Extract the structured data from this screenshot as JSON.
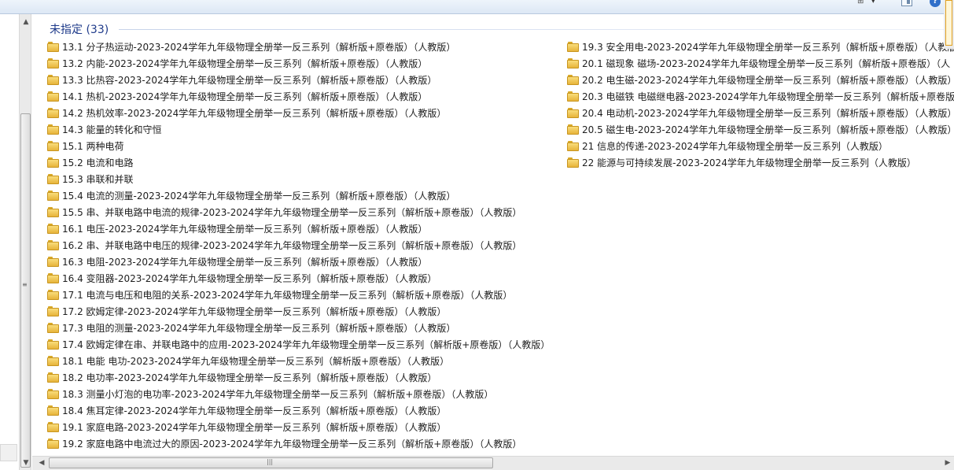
{
  "toolbar": {
    "views_icon": "views-icon",
    "views_glyph": "⊞",
    "views_chevron": "▾",
    "pane_icon": "preview-pane-icon",
    "help_icon": "help-icon",
    "help_glyph": "?"
  },
  "scroll": {
    "up_glyph": "▲",
    "down_glyph": "▼",
    "left_glyph": "◀",
    "right_glyph": "▶",
    "vgrip": "≡",
    "hgrip": "|||"
  },
  "group": {
    "title": "未指定 (33)"
  },
  "items": [
    {
      "name": "13.1  分子热运动-2023-2024学年九年级物理全册举一反三系列（解析版+原卷版）（人教版）"
    },
    {
      "name": "13.2  内能-2023-2024学年九年级物理全册举一反三系列（解析版+原卷版）（人教版）"
    },
    {
      "name": "13.3  比热容-2023-2024学年九年级物理全册举一反三系列（解析版+原卷版）（人教版）"
    },
    {
      "name": "14.1  热机-2023-2024学年九年级物理全册举一反三系列（解析版+原卷版）（人教版）"
    },
    {
      "name": "14.2  热机效率-2023-2024学年九年级物理全册举一反三系列（解析版+原卷版）（人教版）"
    },
    {
      "name": "14.3  能量的转化和守恒"
    },
    {
      "name": "15.1  两种电荷"
    },
    {
      "name": "15.2  电流和电路"
    },
    {
      "name": "15.3  串联和并联"
    },
    {
      "name": "15.4  电流的测量-2023-2024学年九年级物理全册举一反三系列（解析版+原卷版）（人教版）"
    },
    {
      "name": "15.5  串、并联电路中电流的规律-2023-2024学年九年级物理全册举一反三系列（解析版+原卷版）（人教版）"
    },
    {
      "name": "16.1  电压-2023-2024学年九年级物理全册举一反三系列（解析版+原卷版）（人教版）"
    },
    {
      "name": "16.2  串、并联电路中电压的规律-2023-2024学年九年级物理全册举一反三系列（解析版+原卷版）（人教版）"
    },
    {
      "name": "16.3  电阻-2023-2024学年九年级物理全册举一反三系列（解析版+原卷版）（人教版）"
    },
    {
      "name": "16.4  变阻器-2023-2024学年九年级物理全册举一反三系列（解析版+原卷版）（人教版）"
    },
    {
      "name": "17.1  电流与电压和电阻的关系-2023-2024学年九年级物理全册举一反三系列（解析版+原卷版）（人教版）"
    },
    {
      "name": "17.2  欧姆定律-2023-2024学年九年级物理全册举一反三系列（解析版+原卷版）（人教版）"
    },
    {
      "name": "17.3  电阻的测量-2023-2024学年九年级物理全册举一反三系列（解析版+原卷版）（人教版）"
    },
    {
      "name": "17.4  欧姆定律在串、并联电路中的应用-2023-2024学年九年级物理全册举一反三系列（解析版+原卷版）（人教版）"
    },
    {
      "name": "18.1  电能  电功-2023-2024学年九年级物理全册举一反三系列（解析版+原卷版）（人教版）"
    },
    {
      "name": "18.2  电功率-2023-2024学年九年级物理全册举一反三系列（解析版+原卷版）（人教版）"
    },
    {
      "name": "18.3  测量小灯泡的电功率-2023-2024学年九年级物理全册举一反三系列（解析版+原卷版）（人教版）"
    },
    {
      "name": "18.4  焦耳定律-2023-2024学年九年级物理全册举一反三系列（解析版+原卷版）（人教版）"
    },
    {
      "name": "19.1  家庭电路-2023-2024学年九年级物理全册举一反三系列（解析版+原卷版）（人教版）"
    },
    {
      "name": "19.2  家庭电路中电流过大的原因-2023-2024学年九年级物理全册举一反三系列（解析版+原卷版）（人教版）"
    },
    {
      "name": "19.3  安全用电-2023-2024学年九年级物理全册举一反三系列（解析版+原卷版）（人教版"
    },
    {
      "name": "20.1  磁现象  磁场-2023-2024学年九年级物理全册举一反三系列（解析版+原卷版）（人"
    },
    {
      "name": "20.2  电生磁-2023-2024学年九年级物理全册举一反三系列（解析版+原卷版）（人教版）"
    },
    {
      "name": "20.3  电磁铁  电磁继电器-2023-2024学年九年级物理全册举一反三系列（解析版+原卷版"
    },
    {
      "name": "20.4  电动机-2023-2024学年九年级物理全册举一反三系列（解析版+原卷版）（人教版）"
    },
    {
      "name": "20.5  磁生电-2023-2024学年九年级物理全册举一反三系列（解析版+原卷版）（人教版）"
    },
    {
      "name": "21  信息的传递-2023-2024学年九年级物理全册举一反三系列（人教版）"
    },
    {
      "name": "22 能源与可持续发展-2023-2024学年九年级物理全册举一反三系列（人教版）"
    }
  ]
}
